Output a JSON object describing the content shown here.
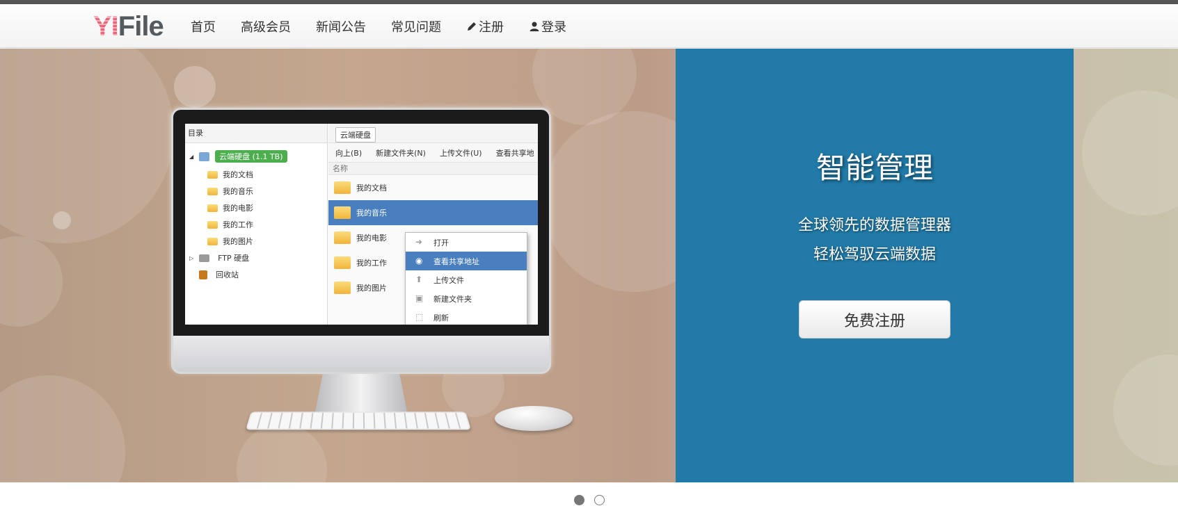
{
  "brand": {
    "logo_yi": "YI",
    "logo_file": "File"
  },
  "nav": {
    "items": [
      {
        "label": "首页"
      },
      {
        "label": "高级会员"
      },
      {
        "label": "新闻公告"
      },
      {
        "label": "常见问题"
      },
      {
        "label": "注册",
        "icon": "pencil-icon"
      },
      {
        "label": "登录",
        "icon": "user-icon"
      }
    ]
  },
  "hero": {
    "title": "智能管理",
    "line1": "全球领先的数据管理器",
    "line2": "轻松驾驭云端数据",
    "cta_label": "免费注册",
    "panel_color": "#217aa8"
  },
  "screen": {
    "tree_header": "目录",
    "root_label": "云端硬盘 (1.1 TB)",
    "folders": [
      "我的文档",
      "我的音乐",
      "我的电影",
      "我的工作",
      "我的图片"
    ],
    "ftp_label": "FTP 硬盘",
    "recycle_label": "回收站",
    "path_chip": "云端硬盘",
    "toolbar": [
      "向上(B)",
      "新建文件夹(N)",
      "上传文件(U)",
      "查看共享地"
    ],
    "column_name": "名称",
    "files": [
      "我的文档",
      "我的音乐",
      "我的电影",
      "我的工作",
      "我的图片"
    ],
    "selected_index": 1,
    "context_menu": [
      "打开",
      "查看共享地址",
      "上传文件",
      "新建文件夹",
      "刷新"
    ],
    "context_active_index": 1
  },
  "carousel": {
    "slides": 2,
    "active": 0
  }
}
